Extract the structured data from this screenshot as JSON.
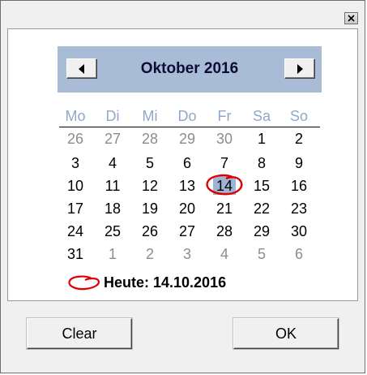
{
  "window": {
    "close_icon": "close-icon"
  },
  "calendar": {
    "month_title": "Oktober 2016",
    "prev_icon": "triangle-left-icon",
    "next_icon": "triangle-right-icon",
    "weekdays": [
      "Mo",
      "Di",
      "Mi",
      "Do",
      "Fr",
      "Sa",
      "So"
    ],
    "weeks": [
      [
        {
          "d": "26",
          "m": "oth"
        },
        {
          "d": "27",
          "m": "oth"
        },
        {
          "d": "28",
          "m": "oth"
        },
        {
          "d": "29",
          "m": "oth"
        },
        {
          "d": "30",
          "m": "oth"
        },
        {
          "d": "1",
          "m": "cur"
        },
        {
          "d": "2",
          "m": "cur"
        }
      ],
      [
        {
          "d": "3",
          "m": "cur"
        },
        {
          "d": "4",
          "m": "cur"
        },
        {
          "d": "5",
          "m": "cur"
        },
        {
          "d": "6",
          "m": "cur"
        },
        {
          "d": "7",
          "m": "cur"
        },
        {
          "d": "8",
          "m": "cur"
        },
        {
          "d": "9",
          "m": "cur"
        }
      ],
      [
        {
          "d": "10",
          "m": "cur"
        },
        {
          "d": "11",
          "m": "cur"
        },
        {
          "d": "12",
          "m": "cur"
        },
        {
          "d": "13",
          "m": "cur"
        },
        {
          "d": "14",
          "m": "cur"
        },
        {
          "d": "15",
          "m": "cur"
        },
        {
          "d": "16",
          "m": "cur"
        }
      ],
      [
        {
          "d": "17",
          "m": "cur"
        },
        {
          "d": "18",
          "m": "cur"
        },
        {
          "d": "19",
          "m": "cur"
        },
        {
          "d": "20",
          "m": "cur"
        },
        {
          "d": "21",
          "m": "cur"
        },
        {
          "d": "22",
          "m": "cur"
        },
        {
          "d": "23",
          "m": "cur"
        }
      ],
      [
        {
          "d": "24",
          "m": "cur"
        },
        {
          "d": "25",
          "m": "cur"
        },
        {
          "d": "26",
          "m": "cur"
        },
        {
          "d": "27",
          "m": "cur"
        },
        {
          "d": "28",
          "m": "cur"
        },
        {
          "d": "29",
          "m": "cur"
        },
        {
          "d": "30",
          "m": "cur"
        }
      ],
      [
        {
          "d": "31",
          "m": "cur"
        },
        {
          "d": "1",
          "m": "oth"
        },
        {
          "d": "2",
          "m": "oth"
        },
        {
          "d": "3",
          "m": "oth"
        },
        {
          "d": "4",
          "m": "oth"
        },
        {
          "d": "5",
          "m": "oth"
        },
        {
          "d": "6",
          "m": "oth"
        }
      ]
    ],
    "selected_day": "14",
    "today_label": "Heute: 14.10.2016",
    "today_marker_icon": "red-circle-icon"
  },
  "buttons": {
    "clear_label": "Clear",
    "ok_label": "OK"
  },
  "colors": {
    "header_band": "#a8bcd6",
    "weekday_text": "#8fa9cc",
    "selected_bg": "#9fb3d4",
    "today_circle": "#e00000",
    "other_month_text": "#8c8c8c"
  }
}
